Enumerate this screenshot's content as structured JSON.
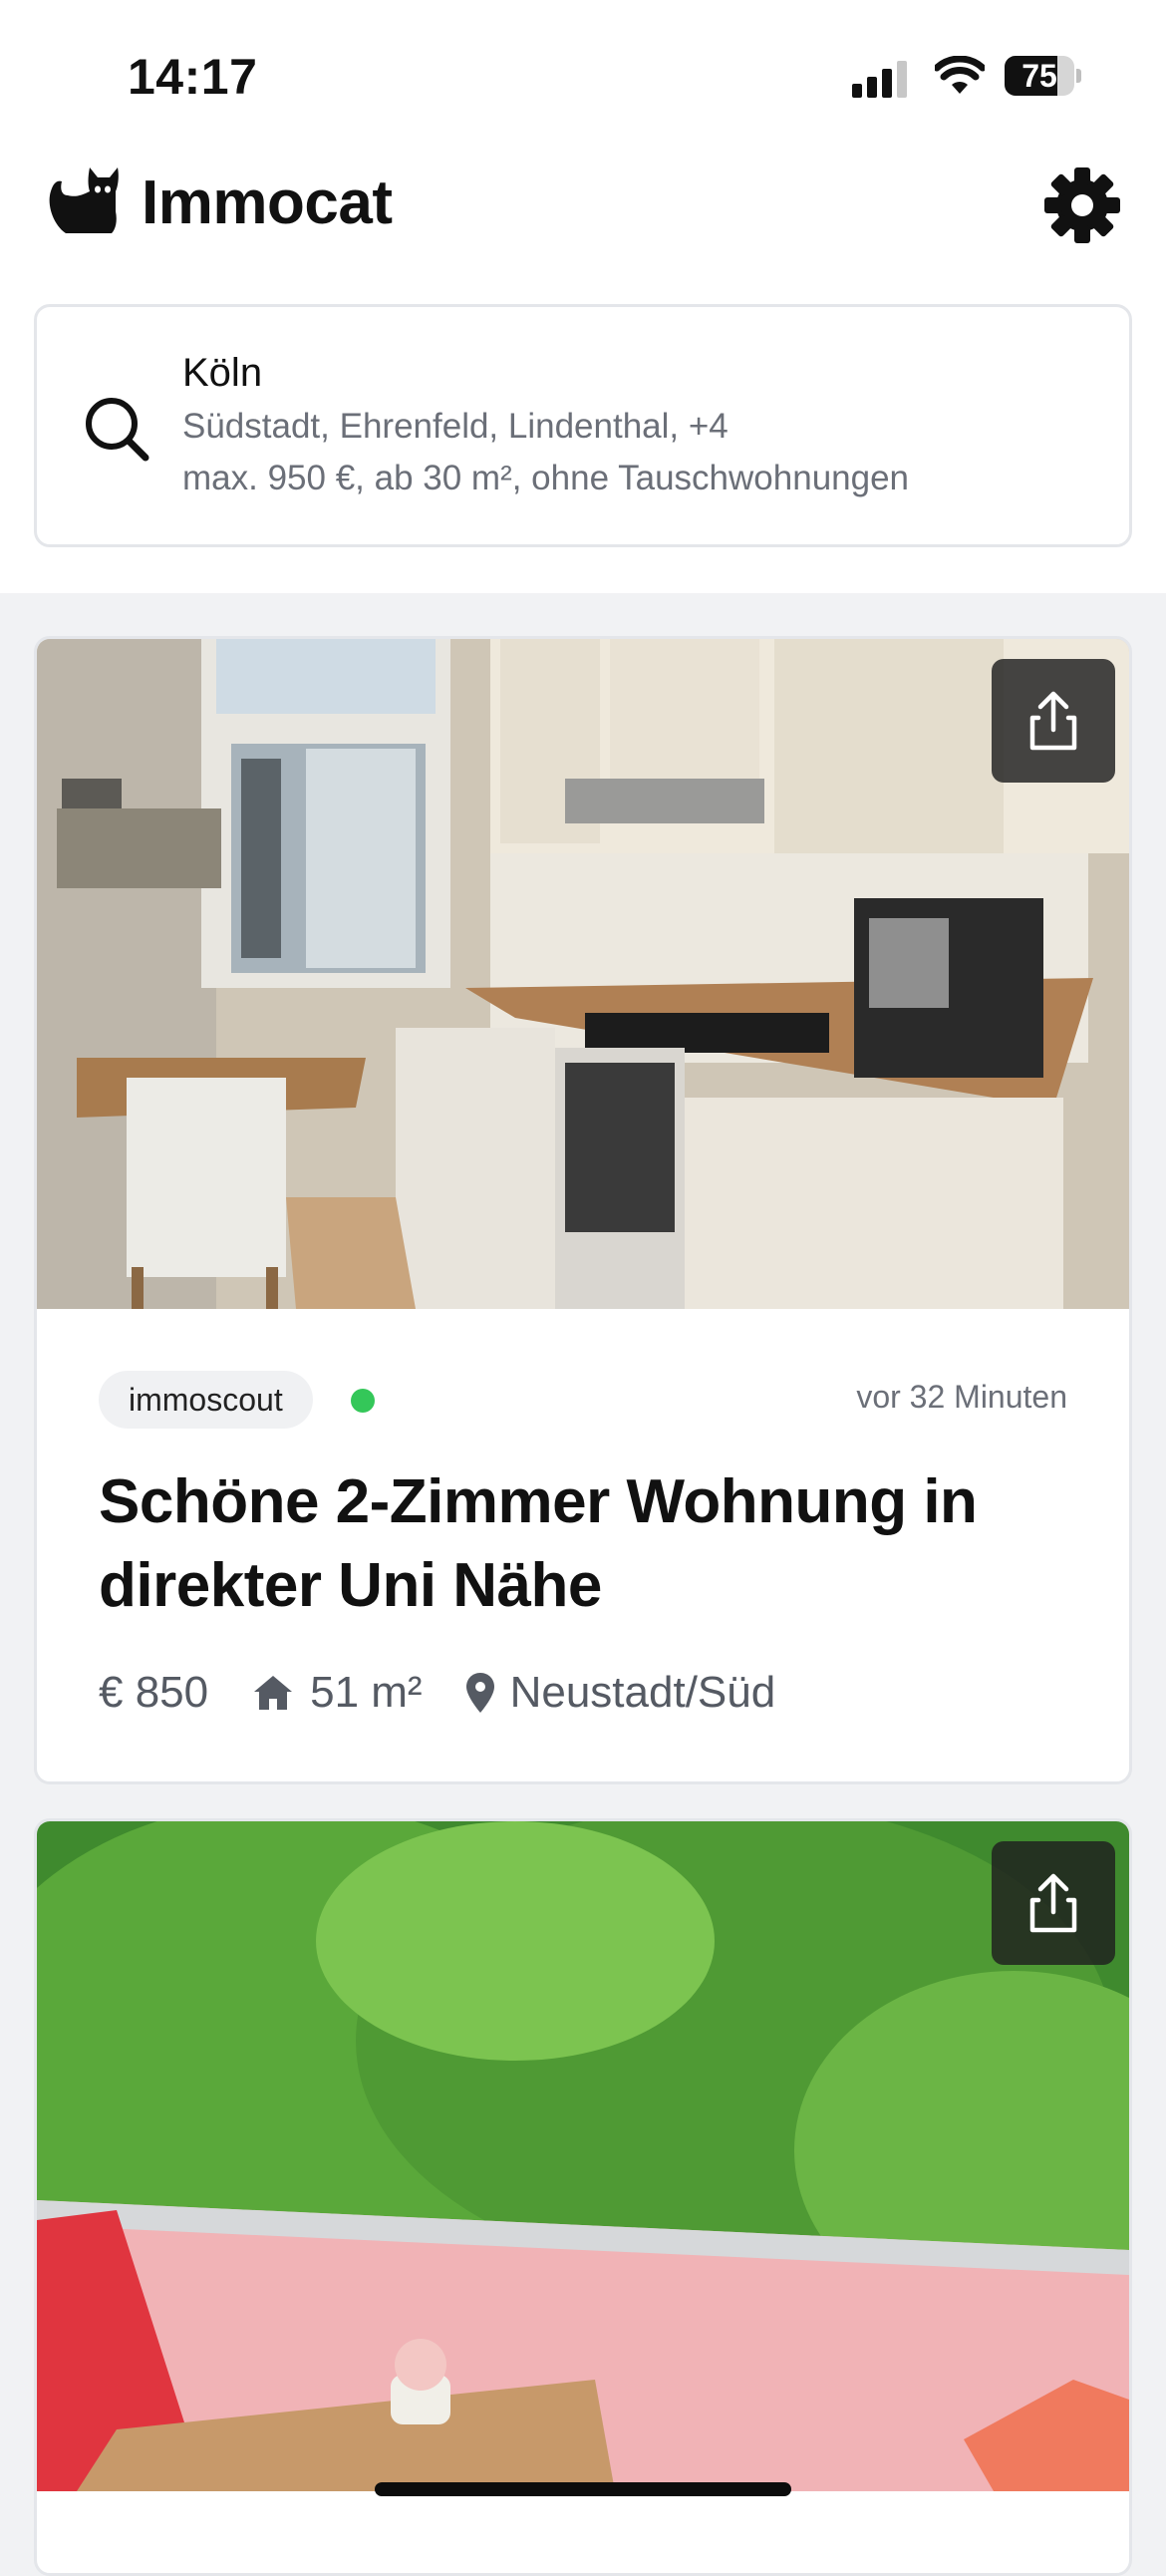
{
  "status_bar": {
    "time": "14:17",
    "battery": "75",
    "battery_level": 0.75
  },
  "app": {
    "title": "Immocat",
    "logo_icon": "cat-logo-icon",
    "settings_icon": "gear-icon"
  },
  "search": {
    "city": "Köln",
    "districts": "Südstadt, Ehrenfeld, Lindenthal, +4",
    "filters": "max. 950 €, ab 30 m², ohne Tauschwohnungen"
  },
  "listings": [
    {
      "source": "immoscout",
      "status_color": "#34c759",
      "posted": "vor 32 Minuten",
      "title": "Schöne 2-Zimmer Wohnung in direkter Uni Nähe",
      "price": "€ 850",
      "area": "51 m²",
      "location": "Neustadt/Süd"
    }
  ]
}
